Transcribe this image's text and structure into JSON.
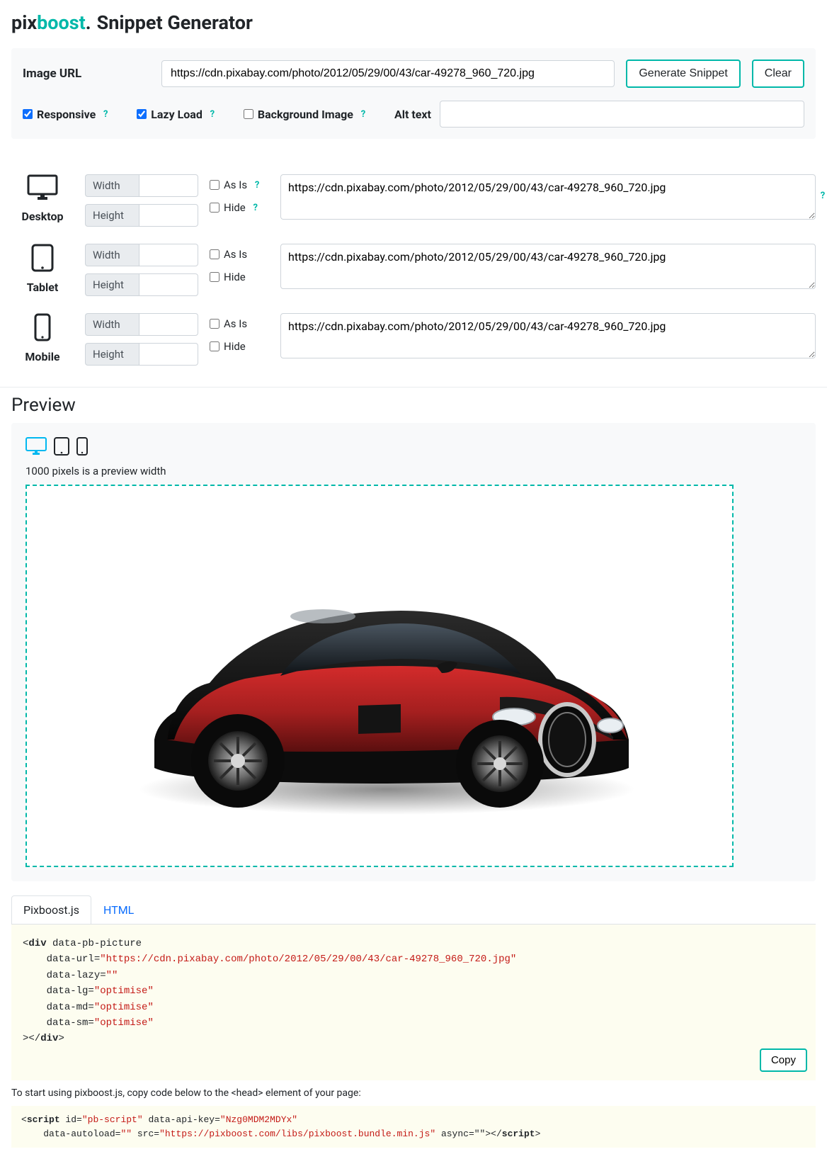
{
  "logo": {
    "pix": "pix",
    "boost": "boost",
    "dot": "."
  },
  "title": "Snippet Generator",
  "imageUrl": {
    "label": "Image URL",
    "value": "https://cdn.pixabay.com/photo/2012/05/29/00/43/car-49278_960_720.jpg"
  },
  "buttons": {
    "generate": "Generate Snippet",
    "clear": "Clear",
    "copy": "Copy"
  },
  "options": {
    "responsive": {
      "label": "Responsive",
      "checked": true
    },
    "lazyLoad": {
      "label": "Lazy Load",
      "checked": true
    },
    "backgroundImage": {
      "label": "Background Image",
      "checked": false
    },
    "altText": {
      "label": "Alt text",
      "value": ""
    }
  },
  "devices": [
    {
      "name": "Desktop",
      "width": "",
      "height": "",
      "asIs": false,
      "hide": false,
      "url": "https://cdn.pixabay.com/photo/2012/05/29/00/43/car-49278_960_720.jpg",
      "showHelpAsIs": true,
      "showHelpHide": true,
      "showRowHelp": true
    },
    {
      "name": "Tablet",
      "width": "",
      "height": "",
      "asIs": false,
      "hide": false,
      "url": "https://cdn.pixabay.com/photo/2012/05/29/00/43/car-49278_960_720.jpg",
      "showHelpAsIs": false,
      "showHelpHide": false,
      "showRowHelp": false
    },
    {
      "name": "Mobile",
      "width": "",
      "height": "",
      "asIs": false,
      "hide": false,
      "url": "https://cdn.pixabay.com/photo/2012/05/29/00/43/car-49278_960_720.jpg",
      "showHelpAsIs": false,
      "showHelpHide": false,
      "showRowHelp": false
    }
  ],
  "labels": {
    "width": "Width",
    "height": "Height",
    "asIs": "As Is",
    "hide": "Hide"
  },
  "preview": {
    "heading": "Preview",
    "widthText": "1000 pixels is a preview width",
    "activeDevice": "desktop"
  },
  "tabs": {
    "pixboost": "Pixboost.js",
    "html": "HTML",
    "active": "pixboost"
  },
  "snippet": {
    "indent": "    ",
    "open": "<div",
    "a1name": "data-pb-picture",
    "a2name": "data-url=",
    "a2val": "\"https://cdn.pixabay.com/photo/2012/05/29/00/43/car-49278_960_720.jpg\"",
    "a3name": "data-lazy=",
    "a3val": "\"\"",
    "a4name": "data-lg=",
    "a4val": "\"optimise\"",
    "a5name": "data-md=",
    "a5val": "\"optimise\"",
    "a6name": "data-sm=",
    "a6val": "\"optimise\"",
    "close1": "></",
    "closetag": "div",
    "close2": ">"
  },
  "note": "To start using pixboost.js, copy code below to the <head> element of your page:",
  "scriptSnippet": {
    "open": "<script",
    "idattr": " id=",
    "idval": "\"pb-script\"",
    "keyattr": " data-api-key=",
    "keyval": "\"Nzg0MDM2MDYx\"",
    "line2indent": "    ",
    "autoattr": "data-autoload=",
    "autoval": "\"\"",
    "srcattr": " src=",
    "srcval": "\"https://pixboost.com/libs/pixboost.bundle.min.js\"",
    "asynctxt": " async=\"\">",
    "close1": "</",
    "closetag": "script",
    "close2": ">"
  }
}
